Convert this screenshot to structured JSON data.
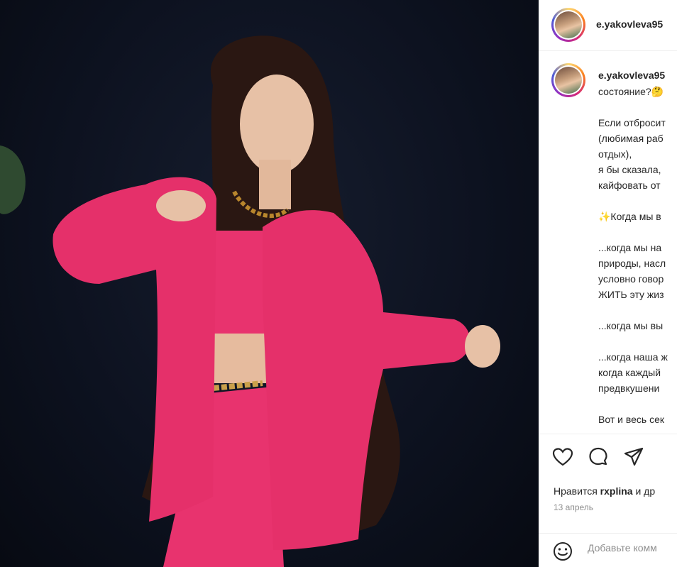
{
  "post": {
    "username": "e.yakovleva95",
    "photo_alt": "pink-suit-photo"
  },
  "caption": {
    "username": "e.yakovleva95",
    "lines": [
      "состояние?🤔",
      "",
      "Если отбросит",
      "(любимая раб",
      "отдых),",
      "я бы сказала,",
      "кайфовать от",
      "",
      "✨Когда мы в",
      "",
      "...когда мы на",
      "природы, насл",
      "условно говор",
      "ЖИТЬ эту жиз",
      "",
      "...когда мы вы",
      "",
      "...когда наша ж",
      "когда каждый",
      "предвкушени",
      "",
      "Вот и весь сек"
    ]
  },
  "actions": {
    "like_icon": "heart-icon",
    "comment_icon": "comment-icon",
    "share_icon": "send-icon",
    "likes_prefix": "Нравится ",
    "likes_user": "rxplina",
    "likes_suffix": " и др",
    "date": "13 апрель"
  },
  "comment": {
    "emoji_icon": "smiley-icon",
    "placeholder": "Добавьте комм"
  },
  "colors": {
    "suit": "#e8336e",
    "background": "#0d1220",
    "text": "#262626",
    "muted": "#8e8e8e"
  }
}
